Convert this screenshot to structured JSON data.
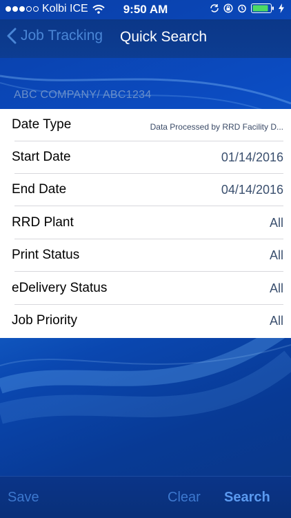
{
  "status_bar": {
    "carrier": "Kolbi ICE",
    "time": "9:50 AM",
    "signal_strength": 3,
    "icons": [
      "wifi-icon",
      "sync-icon",
      "lock-rotation-icon",
      "alarm-icon",
      "battery-icon",
      "charging-bolt-icon"
    ]
  },
  "nav": {
    "back_label": "Job Tracking",
    "title": "Quick Search"
  },
  "company_line": "ABC COMPANY/  ABC1234",
  "fields": [
    {
      "label": "Date Type",
      "value": "Data Processed by RRD Facility D..."
    },
    {
      "label": "Start Date",
      "value": "01/14/2016"
    },
    {
      "label": "End Date",
      "value": "04/14/2016"
    },
    {
      "label": "RRD Plant",
      "value": "All"
    },
    {
      "label": "Print Status",
      "value": "All"
    },
    {
      "label": "eDelivery Status",
      "value": "All"
    },
    {
      "label": "Job Priority",
      "value": "All"
    }
  ],
  "toolbar": {
    "save_label": "Save",
    "clear_label": "Clear",
    "search_label": "Search"
  },
  "colors": {
    "accent": "#3d78cf",
    "background": "#0b44a8",
    "nav_bar": "#0b3788"
  }
}
